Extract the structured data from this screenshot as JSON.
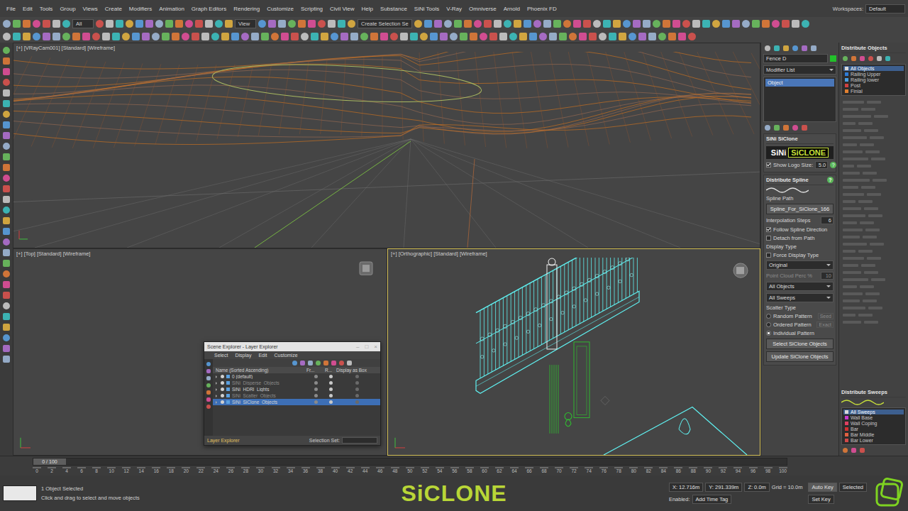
{
  "menu": [
    "File",
    "Edit",
    "Tools",
    "Group",
    "Views",
    "Create",
    "Modifiers",
    "Animation",
    "Graph Editors",
    "Rendering",
    "Customize",
    "Scripting",
    "Civil View",
    "Help",
    "Substance",
    "SiNi Tools",
    "V-Ray",
    "Omniverse",
    "Arnold",
    "Phoenix FD"
  ],
  "workspace": {
    "label": "Workspaces:",
    "value": "Default"
  },
  "toolbar": {
    "selection_filter": "All",
    "view": "View",
    "named_set": "Create Selection Se"
  },
  "viewports": {
    "camera": {
      "label": "[+] [VRayCam001] [Standard] [Wireframe]",
      "active": false
    },
    "top": {
      "label": "[+] [Top] [Standard] [Wireframe]",
      "active": false
    },
    "ortho": {
      "label": "[+] [Orthographic] [Standard] [Wireframe]",
      "active": true
    }
  },
  "command_panel": {
    "object_name": "Fence D",
    "object_color": "#22c02a",
    "modifier_list": "Modifier List",
    "stack": [
      {
        "label": "Object",
        "selected": true
      }
    ],
    "siclone_rollout": {
      "title": "SiNi SiClone",
      "logo_left": "SiNi",
      "logo_right": "SiCLONE",
      "show_logo": {
        "label": "Show Logo Size:",
        "value": "5.0",
        "checked": true
      },
      "help": "?"
    },
    "spline_rollout": {
      "title": "Distribute Spline",
      "help": "?",
      "spline_path_label": "Spline Path",
      "spline_path": "Spline_For_SiClone_166",
      "interp_label": "Interpolation Steps",
      "interp_value": "6",
      "checks": [
        {
          "label": "Follow Spline Direction",
          "checked": true
        },
        {
          "label": "Detach from Path",
          "checked": false
        }
      ],
      "display_type_label": "Display Type",
      "force_display": {
        "label": "Force Display Type",
        "checked": false
      },
      "display_dropdown": "Original",
      "point_cloud": {
        "label": "Point Cloud Perc %",
        "value": "10",
        "disabled": true
      },
      "object_dropdown": "All Objects",
      "sweep_dropdown": "All Sweeps",
      "scatter_label": "Scatter Type",
      "scatter": [
        {
          "label": "Random Pattern",
          "selected": false,
          "side": "Seed"
        },
        {
          "label": "Ordered Pattern",
          "selected": false,
          "side": "Exact"
        },
        {
          "label": "Individual Pattern",
          "selected": true,
          "side": ""
        }
      ],
      "buttons": [
        "Select SiClone Objects",
        "Update SiClone Objects"
      ]
    }
  },
  "right_panel": {
    "objects_title": "Distribute Objects",
    "objects": [
      {
        "label": "All Objects",
        "selected": true,
        "color": "#d8d8d8"
      },
      {
        "label": "Railing Upper",
        "selected": false,
        "color": "#2e7bd6"
      },
      {
        "label": "Railing lower",
        "selected": false,
        "color": "#4a9ee0"
      },
      {
        "label": "Post",
        "selected": false,
        "color": "#d04040"
      },
      {
        "label": "Finial",
        "selected": false,
        "color": "#e08030"
      }
    ],
    "sweeps_title": "Distribute Sweeps",
    "sweeps": [
      {
        "label": "All Sweeps",
        "selected": true,
        "color": "#d8d8d8"
      },
      {
        "label": "Wall Base",
        "selected": false,
        "color": "#c83ad0"
      },
      {
        "label": "Wall Coping",
        "selected": false,
        "color": "#e04060"
      },
      {
        "label": "Bar",
        "selected": false,
        "color": "#d03030"
      },
      {
        "label": "Bar Middle",
        "selected": false,
        "color": "#e06040"
      },
      {
        "label": "Bar Lower",
        "selected": false,
        "color": "#d04848"
      }
    ]
  },
  "scene_explorer": {
    "title": "Scene Explorer - Layer Explorer",
    "controls": [
      "–",
      "□",
      "×"
    ],
    "menus": [
      "Select",
      "Display",
      "Edit",
      "Customize"
    ],
    "columns": [
      "Name (Sorted Ascending)",
      "Fr...",
      "R...",
      "Display as Box"
    ],
    "rows": [
      {
        "label": "0 (default)",
        "selected": false,
        "dim": false
      },
      {
        "label": "SiNi_Disperse_Objects",
        "selected": false,
        "dim": true
      },
      {
        "label": "SiNi_HDRI_Lights",
        "selected": false,
        "dim": false
      },
      {
        "label": "SiNi_Scatter_Objects",
        "selected": false,
        "dim": true
      },
      {
        "label": "SiNi_SiClone_Objects",
        "selected": true,
        "dim": false
      }
    ],
    "footer_left": "Layer Explorer",
    "footer_set": "Selection Set:"
  },
  "timeline": {
    "frame": "0 / 100",
    "ticks": [
      "0",
      "2",
      "4",
      "6",
      "8",
      "10",
      "12",
      "14",
      "16",
      "18",
      "20",
      "22",
      "24",
      "26",
      "28",
      "30",
      "32",
      "34",
      "36",
      "38",
      "40",
      "42",
      "44",
      "46",
      "48",
      "50",
      "52",
      "54",
      "56",
      "58",
      "60",
      "62",
      "64",
      "66",
      "68",
      "70",
      "72",
      "74",
      "76",
      "78",
      "80",
      "82",
      "84",
      "86",
      "88",
      "90",
      "92",
      "94",
      "96",
      "98",
      "100"
    ]
  },
  "status_bar": {
    "selection": "1 Object Selected",
    "prompt": "Click and drag to select and move objects",
    "coords": [
      "X: 12.716m",
      "Y: 291.339m",
      "Z: 0.0m"
    ],
    "grid": "Grid = 10.0m",
    "auto_key": "Auto Key",
    "key_filter": "Selected",
    "set_key": "Set Key",
    "enabled": "Enabled:",
    "time_tag": "Add Time Tag"
  },
  "watermark": "SiCLONE"
}
